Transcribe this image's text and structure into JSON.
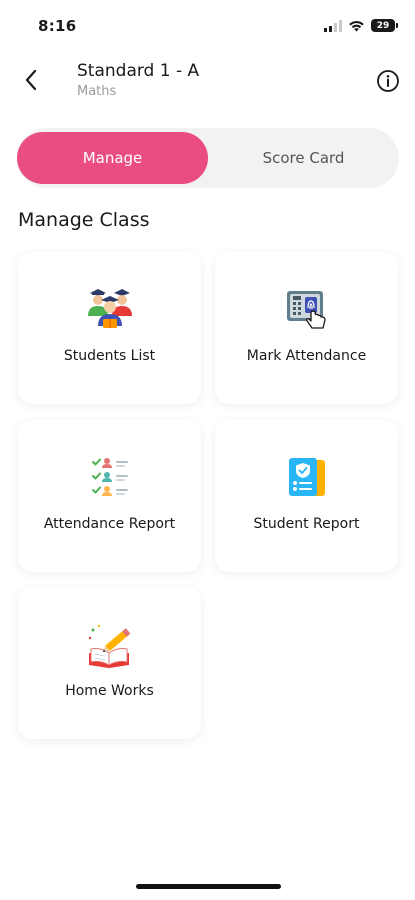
{
  "status_bar": {
    "time": "8:16",
    "battery": "29"
  },
  "header": {
    "title": "Standard 1 - A",
    "subtitle": "Maths"
  },
  "tabs": [
    {
      "label": "Manage",
      "active": true
    },
    {
      "label": "Score Card",
      "active": false
    }
  ],
  "section_title": "Manage Class",
  "cards": [
    {
      "label": "Students List",
      "icon": "students-group-icon"
    },
    {
      "label": "Mark Attendance",
      "icon": "fingerprint-attendance-icon"
    },
    {
      "label": "Attendance Report",
      "icon": "checklist-report-icon"
    },
    {
      "label": "Student Report",
      "icon": "student-id-card-icon"
    },
    {
      "label": "Home Works",
      "icon": "book-pencil-icon"
    }
  ],
  "colors": {
    "accent": "#ea4d82",
    "segment_bg": "#f2f2f4"
  }
}
